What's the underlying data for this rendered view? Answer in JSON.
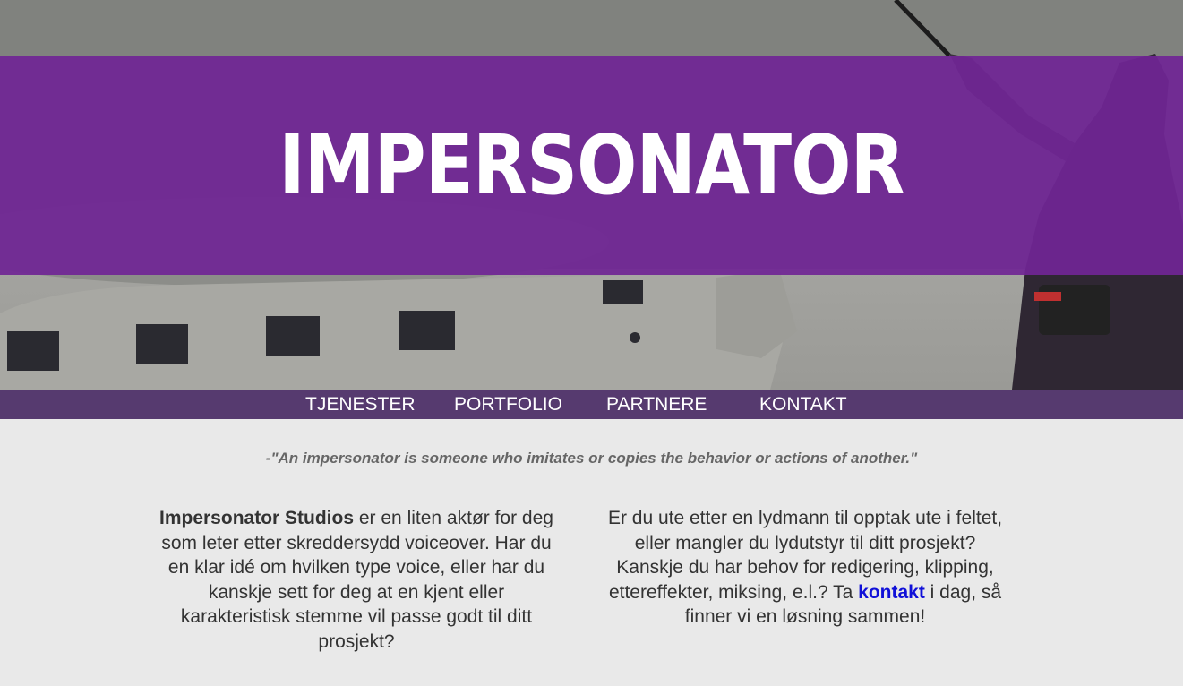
{
  "site": {
    "title": "IMPERSONATOR"
  },
  "nav": {
    "items": [
      "TJENESTER",
      "PORTFOLIO",
      "PARTNERE",
      "KONTAKT"
    ]
  },
  "quote": "-\"An impersonator is someone who imitates or copies the behavior or actions of another.\"",
  "left_column": {
    "brand": "Impersonator Studios",
    "text": " er en liten aktør for deg som leter etter skreddersydd voiceover. Har du en klar idé om hvilken type voice, eller har du kanskje sett for deg at en kjent eller karakteristisk stemme vil passe godt til ditt prosjekt?"
  },
  "right_column": {
    "text_before": "Er du ute etter en lydmann til opptak ute i feltet, eller mangler du lydutstyr til ditt prosjekt? Kanskje du har behov for redigering, klipping, ettereffekter, miksing, e.l.? Ta ",
    "link": "kontakt",
    "text_after": " i dag, så finner vi en løsning sammen!"
  },
  "colors": {
    "banner": "#702694",
    "nav": "#563a6f",
    "link": "#1010d8",
    "page_bg": "#e9e9e9"
  }
}
